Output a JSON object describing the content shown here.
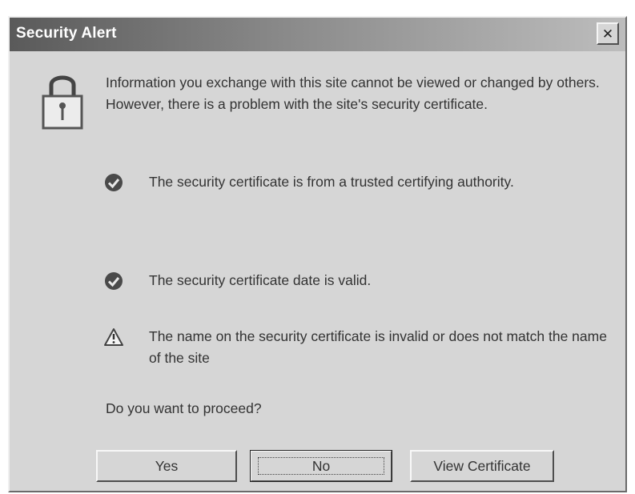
{
  "window": {
    "title": "Security Alert",
    "close_glyph": "✕"
  },
  "icons": {
    "lock": "lock-icon",
    "check": "check-icon",
    "warning": "warning-icon"
  },
  "message": {
    "intro": "Information you exchange with this site cannot be viewed or changed by others. However, there is a problem with the site's security certificate."
  },
  "items": [
    {
      "icon": "check-icon",
      "text": "The security certificate is from a trusted certifying authority."
    },
    {
      "icon": "check-icon",
      "text": "The security certificate date is valid."
    },
    {
      "icon": "warning-icon",
      "text": "The name on the security certificate is invalid or does not match the name of the site"
    }
  ],
  "question": "Do you want to proceed?",
  "buttons": {
    "yes": "Yes",
    "no": "No",
    "view_certificate": "View Certificate"
  },
  "colors": {
    "dialog_background": "#d6d6d6",
    "titlebar_dark": "#5a5a5a",
    "titlebar_light": "#bdbdbd",
    "text": "#333333"
  }
}
